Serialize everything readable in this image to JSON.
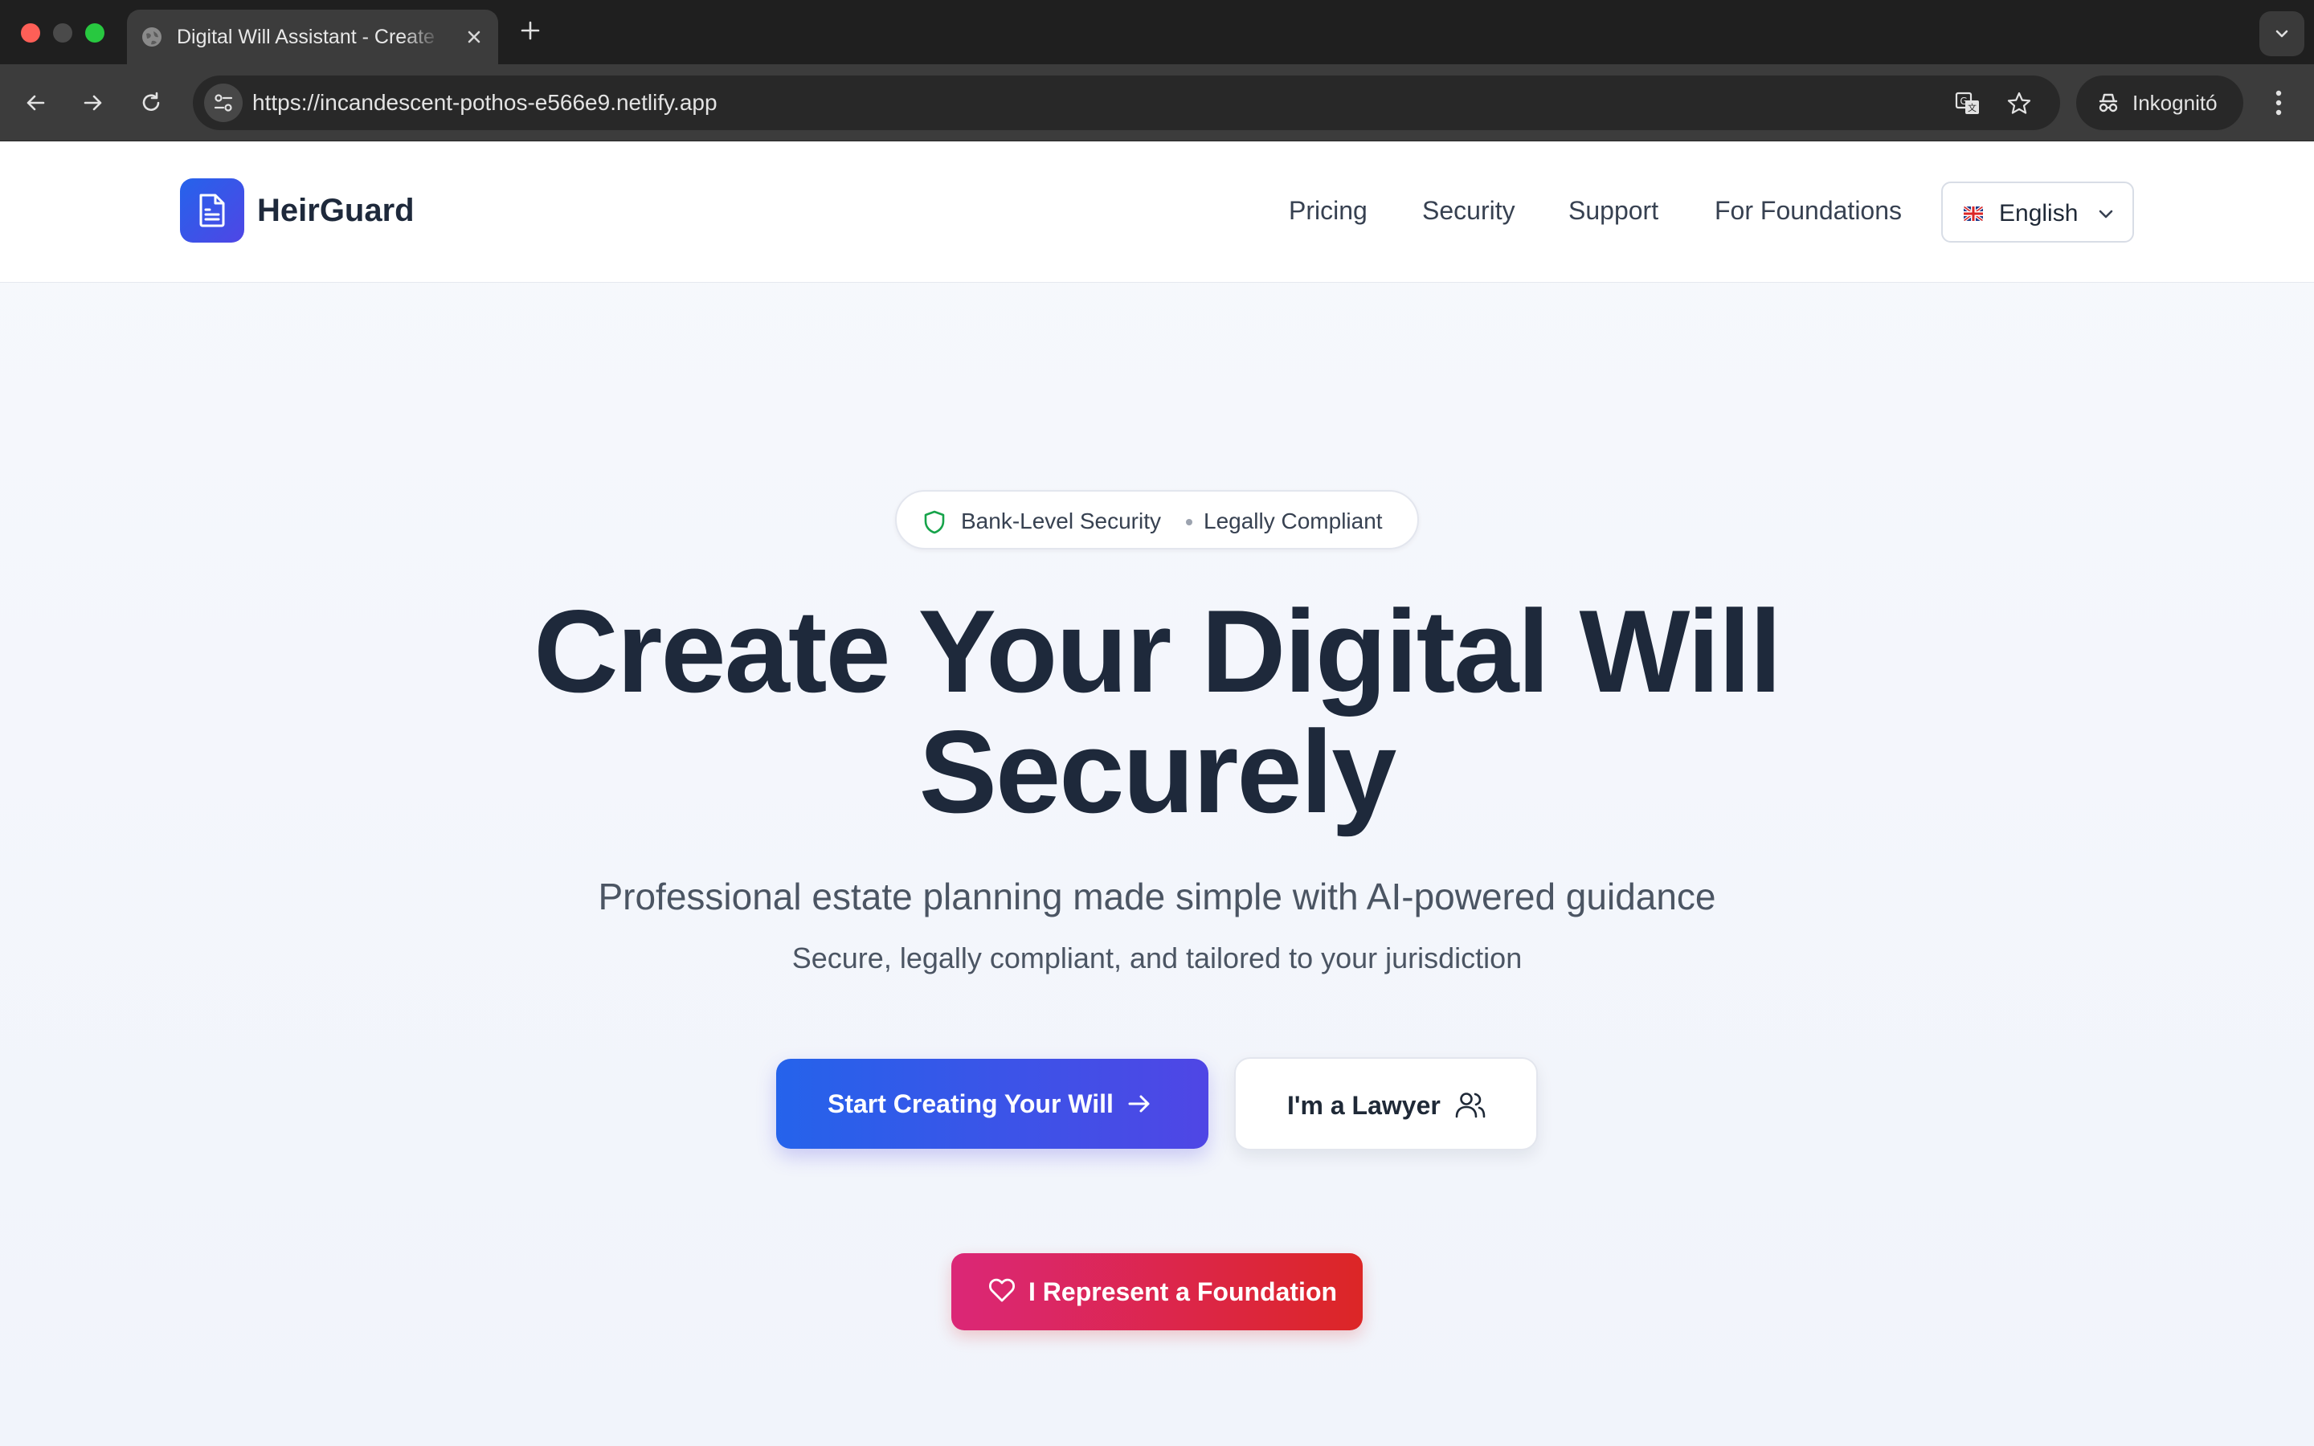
{
  "browser": {
    "tab_title": "Digital Will Assistant - Create",
    "url": "https://incandescent-pothos-e566e9.netlify.app",
    "incognito_label": "Inkognitó"
  },
  "header": {
    "brand": "HeirGuard",
    "nav": [
      "Pricing",
      "Security",
      "Support",
      "For Foundations"
    ],
    "language": "English"
  },
  "hero": {
    "badge_left": "Bank-Level Security",
    "badge_right": "Legally Compliant",
    "title_line1": "Create Your Digital Will",
    "title_line2": "Securely",
    "subtitle": "Professional estate planning made simple with AI-powered guidance",
    "subtitle2": "Secure, legally compliant, and tailored to your jurisdiction",
    "primary_cta": "Start Creating Your Will",
    "secondary_cta": "I'm a Lawyer",
    "foundation_cta": "I Represent a Foundation"
  },
  "colors": {
    "primary_gradient": [
      "#2563eb",
      "#4f46e5"
    ],
    "foundation_gradient": [
      "#db2777",
      "#dc2626"
    ],
    "text_dark": "#1e293b",
    "security_green": "#16a34a"
  }
}
